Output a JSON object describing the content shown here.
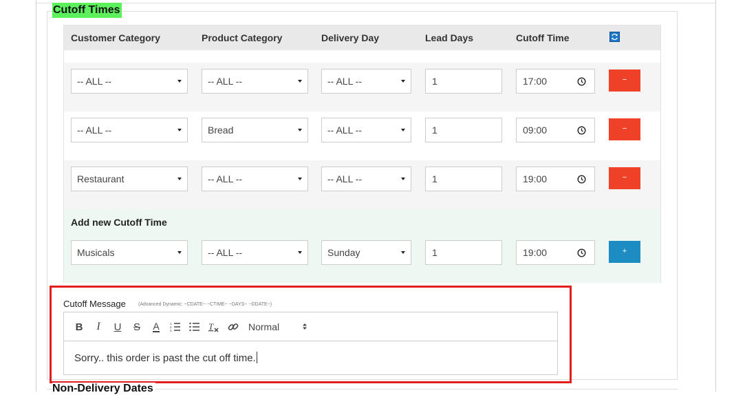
{
  "section": {
    "title": "Cutoff Times",
    "next_section_title": "Non-Delivery Dates"
  },
  "table": {
    "headers": [
      "Customer Category",
      "Product Category",
      "Delivery Day",
      "Lead Days",
      "Cutoff Time"
    ],
    "refresh_icon": "refresh-icon",
    "rows": [
      {
        "customer": "-- ALL --",
        "product": "-- ALL --",
        "day": "-- ALL --",
        "lead": "1",
        "time": "17:00",
        "action": "−"
      },
      {
        "customer": "-- ALL --",
        "product": "Bread",
        "day": "-- ALL --",
        "lead": "1",
        "time": "09:00",
        "action": "−"
      },
      {
        "customer": "Restaurant",
        "product": "-- ALL --",
        "day": "-- ALL --",
        "lead": "1",
        "time": "19:00",
        "action": "−"
      }
    ],
    "add_row": {
      "title": "Add new Cutoff Time",
      "customer": "Musicals",
      "product": "-- ALL --",
      "day": "Sunday",
      "lead": "1",
      "time": "19:00",
      "action": "+"
    }
  },
  "message": {
    "label": "Cutoff Message",
    "hint": "(Advanced Dynamic: ~CDATE~ ~CTIME~ ~DAYS~ ~DDATE~)",
    "toolbar": {
      "bold": "B",
      "italic": "I",
      "underline": "U",
      "strike": "S",
      "color": "A",
      "clear": "Tx",
      "header": "Normal"
    },
    "body": "Sorry.. this order is past the cut off time."
  },
  "colors": {
    "section_title_bg": "#5df05d",
    "remove_button": "#ee4128",
    "add_button": "#1d8cc2",
    "highlight_border": "#e11d1d"
  }
}
